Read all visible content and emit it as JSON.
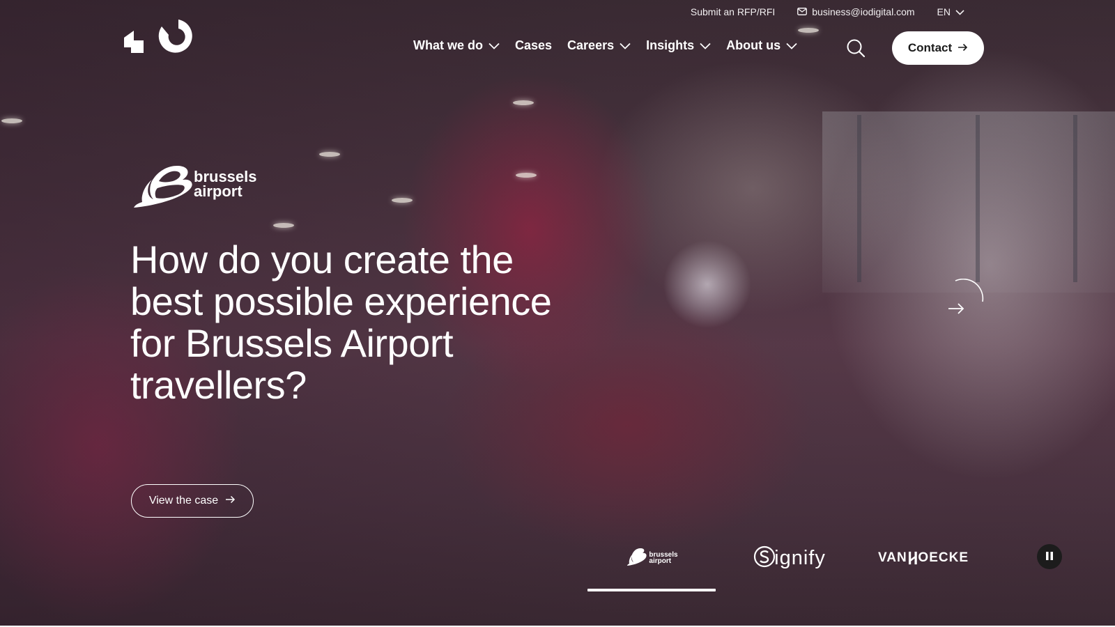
{
  "topbar": {
    "rfp_link": "Submit an RFP/RFI",
    "email": "business@iodigital.com",
    "language": "EN",
    "icons": {
      "email": "mail-icon",
      "language_dropdown": "chevron-down-icon"
    }
  },
  "nav": {
    "items": [
      {
        "label": "What we do",
        "has_dropdown": true
      },
      {
        "label": "Cases",
        "has_dropdown": false
      },
      {
        "label": "Careers",
        "has_dropdown": true
      },
      {
        "label": "Insights",
        "has_dropdown": true
      },
      {
        "label": "About us",
        "has_dropdown": true
      }
    ],
    "search_icon": "search-icon",
    "contact_label": "Contact"
  },
  "hero": {
    "client_logo_text": "brussels airport",
    "client_logo_lines": [
      "brussels",
      "airport"
    ],
    "headline": "How do you create the best possible experience for Brussels Airport travellers?",
    "cta_label": "View the case",
    "next_icon": "arrow-right-icon"
  },
  "carousel": {
    "logos": [
      {
        "name": "brussels airport",
        "active": true
      },
      {
        "name": "signify",
        "active": false
      },
      {
        "name": "VAN HOECKE",
        "active": false
      }
    ],
    "active_index": 0,
    "pause_icon": "pause-icon"
  },
  "colors": {
    "text": "#ffffff",
    "button_bg": "#ffffff",
    "button_text": "#1b1b1b",
    "pause_bg": "#1c1c1c"
  }
}
